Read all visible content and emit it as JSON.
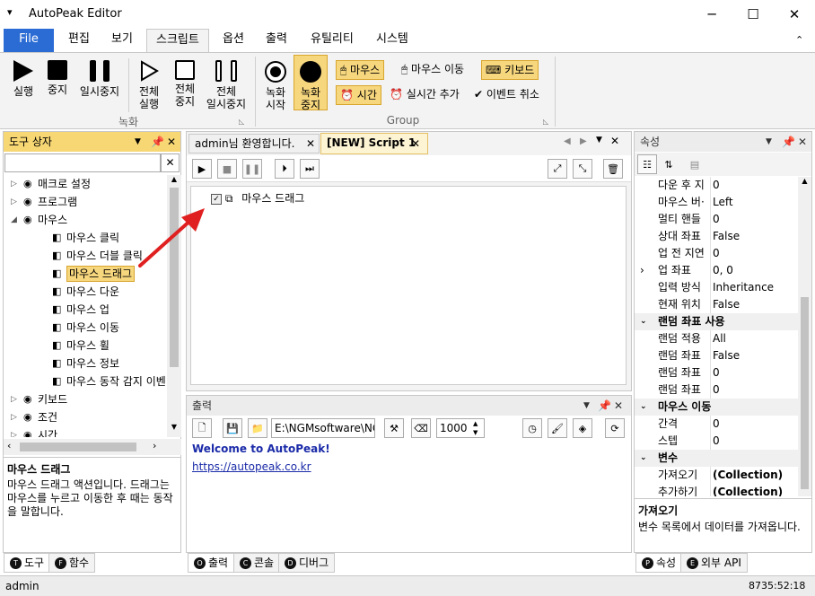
{
  "window": {
    "title": "AutoPeak Editor",
    "menu_glyph": "▾",
    "min": "─",
    "max": "☐",
    "close": "✕"
  },
  "menu": {
    "file": "File",
    "items": [
      "편집",
      "보기",
      "스크립트",
      "옵션",
      "출력",
      "유틸리티",
      "시스템"
    ],
    "collapse": "⌃"
  },
  "ribbon": {
    "record_group": "녹화",
    "group2": "Group",
    "buttons": [
      "실행",
      "중지",
      "일시중지"
    ],
    "all_buttons": [
      "전체\n실행",
      "전체\n중지",
      "전체\n일시중지"
    ],
    "rec_buttons": [
      "녹화\n시작",
      "녹화\n중지"
    ],
    "toggles": {
      "mouse": "마우스",
      "mouse_move": "마우스 이동",
      "keyboard": "키보드",
      "time": "시간",
      "realtime_add": "실시간 추가",
      "event_cancel": "이벤트 취소"
    }
  },
  "toolbox": {
    "title": "도구 상자",
    "items": [
      {
        "label": "매크로 설정",
        "level": 0,
        "exp": "▷"
      },
      {
        "label": "프로그램",
        "level": 0,
        "exp": "▷"
      },
      {
        "label": "마우스",
        "level": 0,
        "exp": "◢"
      },
      {
        "label": "마우스 클릭",
        "level": 1
      },
      {
        "label": "마우스 더블 클릭",
        "level": 1
      },
      {
        "label": "마우스 드래그",
        "level": 1,
        "selected": true
      },
      {
        "label": "마우스 다운",
        "level": 1
      },
      {
        "label": "마우스 업",
        "level": 1
      },
      {
        "label": "마우스 이동",
        "level": 1
      },
      {
        "label": "마우스 휠",
        "level": 1
      },
      {
        "label": "마우스 정보",
        "level": 1
      },
      {
        "label": "마우스 동작 감지 이벤",
        "level": 1
      },
      {
        "label": "키보드",
        "level": 0,
        "exp": "▷"
      },
      {
        "label": "조건",
        "level": 0,
        "exp": "▷"
      },
      {
        "label": "시간",
        "level": 0,
        "exp": "▷"
      }
    ],
    "desc_title": "마우스 드래그",
    "desc_text": "마우스 드래그 액션입니다. 드래그는 마우스를 누르고 이동한 후 때는 동작을 말합니다.",
    "tabs": [
      {
        "key": "T",
        "label": "도구"
      },
      {
        "key": "F",
        "label": "함수"
      }
    ]
  },
  "editor": {
    "tabs": [
      "admin님 환영합니다.",
      "[NEW] Script 1"
    ],
    "item": "마우스 드래그"
  },
  "output": {
    "title": "출력",
    "path": "E:\\NGMsoftware\\NG",
    "count": "1000",
    "welcome": "Welcome to AutoPeak!",
    "link": "https://autopeak.co.kr",
    "tabs": [
      {
        "key": "O",
        "label": "출력"
      },
      {
        "key": "C",
        "label": "콘솔"
      },
      {
        "key": "D",
        "label": "디버그"
      }
    ]
  },
  "properties": {
    "title": "속성",
    "rows": [
      {
        "type": "p",
        "name": "다운 후 지",
        "value": "0"
      },
      {
        "type": "p",
        "name": "마우스 버·",
        "value": "Left"
      },
      {
        "type": "p",
        "name": "멀티 핸들",
        "value": "0"
      },
      {
        "type": "p",
        "name": "상대 좌표",
        "value": "False"
      },
      {
        "type": "p",
        "name": "업 전 지연",
        "value": "0"
      },
      {
        "type": "p",
        "name": "업 좌표",
        "value": "0, 0",
        "exp": "›"
      },
      {
        "type": "p",
        "name": "입력 방식",
        "value": "Inheritance"
      },
      {
        "type": "p",
        "name": "현재 위치",
        "value": "False"
      },
      {
        "type": "c",
        "name": "랜덤 좌표 사용"
      },
      {
        "type": "p",
        "name": "랜덤 적용",
        "value": "All"
      },
      {
        "type": "p",
        "name": "랜덤 좌표",
        "value": "False"
      },
      {
        "type": "p",
        "name": "랜덤 좌표",
        "value": "0"
      },
      {
        "type": "p",
        "name": "랜덤 좌표",
        "value": "0"
      },
      {
        "type": "c",
        "name": "마우스 이동"
      },
      {
        "type": "p",
        "name": "간격",
        "value": "0"
      },
      {
        "type": "p",
        "name": "스텝",
        "value": "0"
      },
      {
        "type": "c",
        "name": "변수"
      },
      {
        "type": "p",
        "name": "가져오기",
        "value": "(Collection)",
        "bold": true
      },
      {
        "type": "p",
        "name": "추가하기",
        "value": "(Collection)",
        "bold": true
      }
    ],
    "desc_title": "가져오기",
    "desc_text": "변수 목록에서 데이터를 가져옵니다.",
    "tabs": [
      {
        "key": "P",
        "label": "속성"
      },
      {
        "key": "E",
        "label": "외부 API"
      }
    ]
  },
  "status": {
    "user": "admin",
    "time": "8735:52:18"
  },
  "colors": {
    "accent": "#2b6cd4",
    "highlight": "#f7d77e",
    "arrow": "#e02020"
  }
}
